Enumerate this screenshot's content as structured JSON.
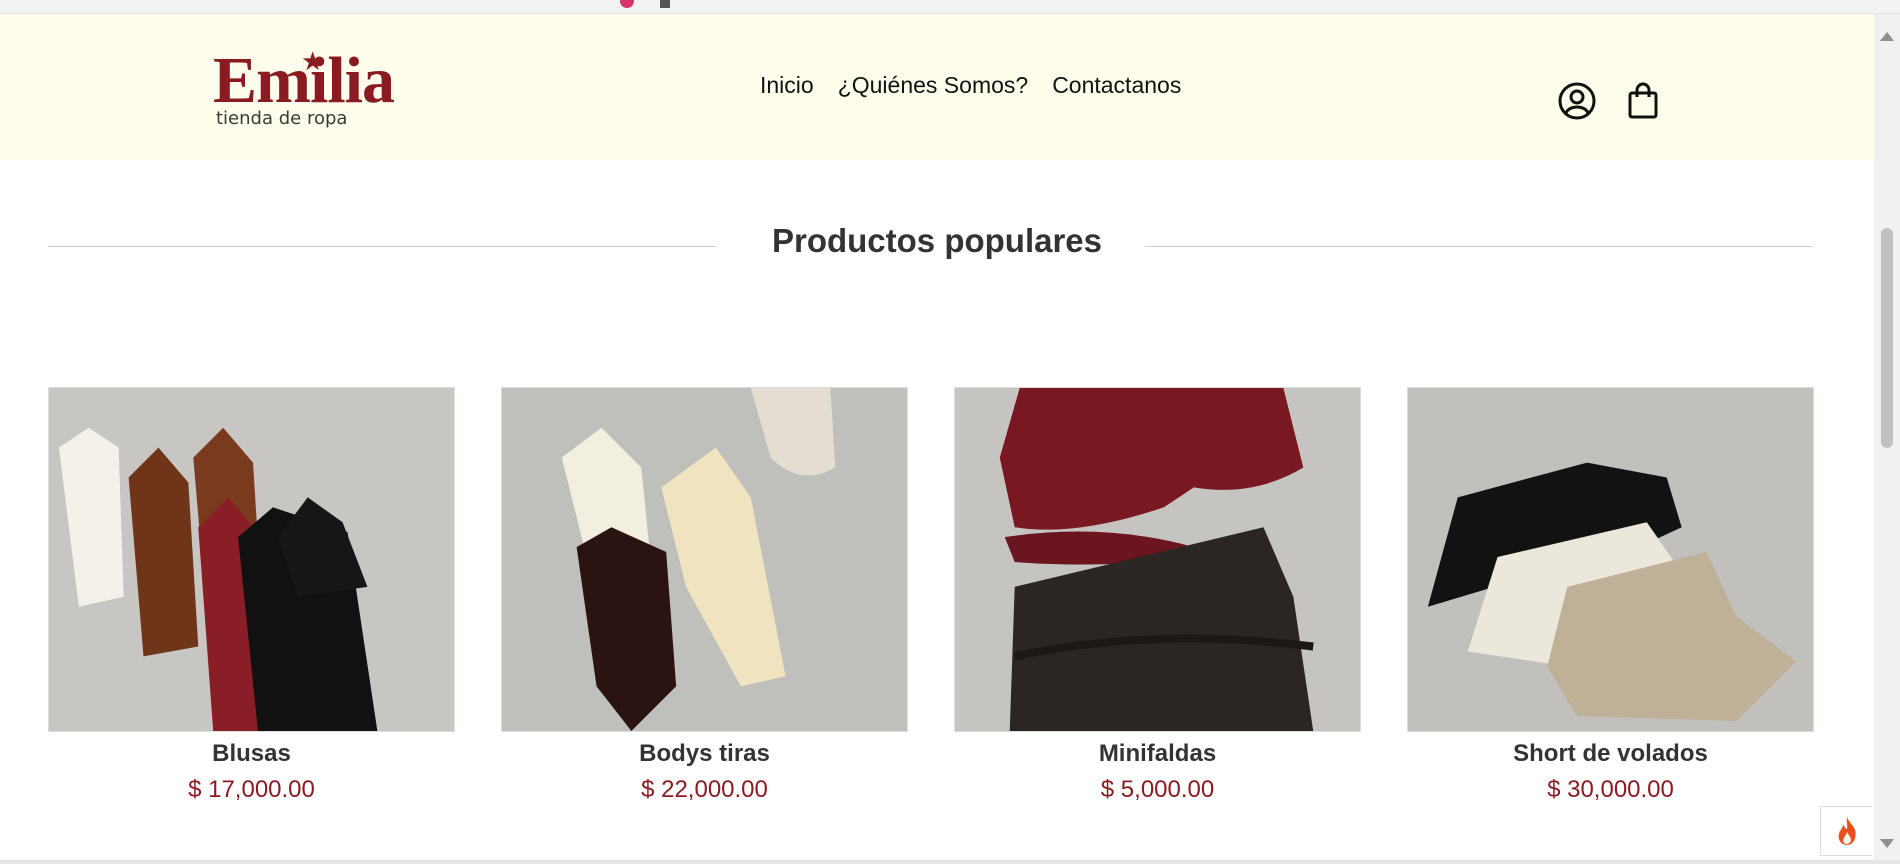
{
  "brand": {
    "name": "Emilia",
    "tagline": "tienda de ropa",
    "color": "#8b1b22"
  },
  "nav": {
    "items": [
      {
        "label": "Inicio"
      },
      {
        "label": "¿Quiénes Somos?"
      },
      {
        "label": "Contactanos"
      }
    ]
  },
  "header_icons": [
    "user-circle-icon",
    "shopping-bag-icon"
  ],
  "section": {
    "title": "Productos populares"
  },
  "products": [
    {
      "name": "Blusas",
      "price": "$ 17,000.00",
      "image_icon": "tank-tops-image"
    },
    {
      "name": "Bodys tiras",
      "price": "$ 22,000.00",
      "image_icon": "bodysuits-image"
    },
    {
      "name": "Minifaldas",
      "price": "$ 5,000.00",
      "image_icon": "ruffled-skirts-image"
    },
    {
      "name": "Short de volados",
      "price": "$ 30,000.00",
      "image_icon": "ruffled-shorts-image"
    }
  ],
  "colors": {
    "header_bg": "#fffeec",
    "price": "#8b1b22",
    "title": "#333333"
  }
}
